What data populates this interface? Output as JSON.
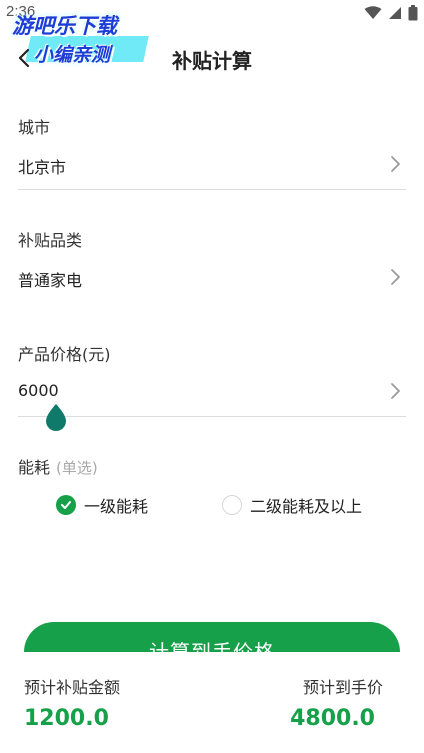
{
  "status_bar": {
    "time": "2:36"
  },
  "watermark": {
    "line1": "游吧乐下载",
    "line2": "小编亲测"
  },
  "header": {
    "title": "补贴计算"
  },
  "city": {
    "label": "城市",
    "value": "北京市"
  },
  "category": {
    "label": "补贴品类",
    "value": "普通家电"
  },
  "price": {
    "label": "产品价格(元)",
    "value": "6000",
    "slider_fraction": 0.1
  },
  "energy": {
    "label": "能耗",
    "hint": "(单选)",
    "options": [
      {
        "label": "一级能耗",
        "selected": true
      },
      {
        "label": "二级能耗及以上",
        "selected": false
      }
    ]
  },
  "calculate_button": {
    "label": "计算到手价格"
  },
  "result": {
    "subsidy_label": "预计补贴金额",
    "subsidy_value": "1200.0",
    "final_label": "预计到手价",
    "final_value": "4800.0"
  },
  "colors": {
    "accent": "#16a049",
    "slider": "#0f7a6a",
    "divider": "#dcdcdc"
  }
}
